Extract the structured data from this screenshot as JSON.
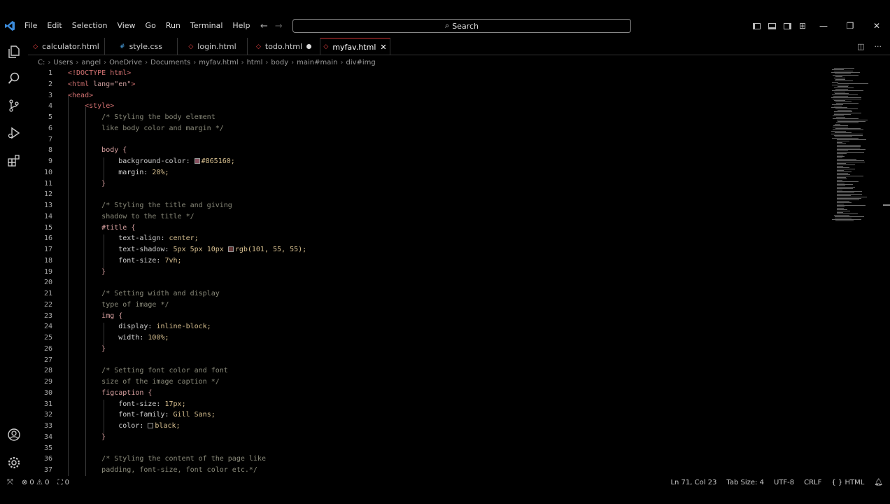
{
  "menu": [
    "File",
    "Edit",
    "Selection",
    "View",
    "Go",
    "Run",
    "Terminal",
    "Help"
  ],
  "search": {
    "placeholder": "Search"
  },
  "tabs": [
    {
      "label": "calculator.html"
    },
    {
      "label": "style.css"
    },
    {
      "label": "login.html"
    },
    {
      "label": "todo.html"
    },
    {
      "label": "myfav.html"
    }
  ],
  "breadcrumb": [
    "C:",
    "Users",
    "angel",
    "OneDrive",
    "Documents",
    "myfav.html",
    "html",
    "body",
    "main#main",
    "div#img"
  ],
  "code_lines": [
    {
      "n": "1",
      "parts": [
        [
          "tag",
          "<!DOCTYPE html>"
        ]
      ]
    },
    {
      "n": "2",
      "parts": [
        [
          "tag",
          "<html "
        ],
        [
          "attr",
          "lang=\"en\""
        ],
        [
          "tag",
          ">"
        ]
      ]
    },
    {
      "n": "3",
      "parts": [
        [
          "tag",
          "<head>"
        ]
      ]
    },
    {
      "n": "4",
      "parts": [
        [
          "pad",
          "    "
        ],
        [
          "tag",
          "<style>"
        ]
      ]
    },
    {
      "n": "5",
      "parts": [
        [
          "pad",
          "        "
        ],
        [
          "com",
          "/* Styling the body element"
        ]
      ]
    },
    {
      "n": "6",
      "parts": [
        [
          "pad",
          "        "
        ],
        [
          "com",
          "like body color and margin */"
        ]
      ]
    },
    {
      "n": "7",
      "parts": []
    },
    {
      "n": "8",
      "parts": [
        [
          "pad",
          "        "
        ],
        [
          "sel",
          "body {"
        ]
      ]
    },
    {
      "n": "9",
      "parts": [
        [
          "pad",
          "            "
        ],
        [
          "prop",
          "background-color: "
        ],
        [
          "swatch",
          "#865160"
        ],
        [
          "val",
          "#865160;"
        ]
      ]
    },
    {
      "n": "10",
      "parts": [
        [
          "pad",
          "            "
        ],
        [
          "prop",
          "margin: "
        ],
        [
          "val",
          "20%;"
        ]
      ]
    },
    {
      "n": "11",
      "parts": [
        [
          "pad",
          "        "
        ],
        [
          "sel",
          "}"
        ]
      ]
    },
    {
      "n": "12",
      "parts": []
    },
    {
      "n": "13",
      "parts": [
        [
          "pad",
          "        "
        ],
        [
          "com",
          "/* Styling the title and giving"
        ]
      ]
    },
    {
      "n": "14",
      "parts": [
        [
          "pad",
          "        "
        ],
        [
          "com",
          "shadow to the title */"
        ]
      ]
    },
    {
      "n": "15",
      "parts": [
        [
          "pad",
          "        "
        ],
        [
          "sel",
          "#title {"
        ]
      ]
    },
    {
      "n": "16",
      "parts": [
        [
          "pad",
          "            "
        ],
        [
          "prop",
          "text-align: "
        ],
        [
          "val",
          "center;"
        ]
      ]
    },
    {
      "n": "17",
      "parts": [
        [
          "pad",
          "            "
        ],
        [
          "prop",
          "text-shadow: "
        ],
        [
          "val",
          "5px 5px 10px "
        ],
        [
          "swatch",
          "#653737"
        ],
        [
          "val",
          "rgb(101, 55, 55);"
        ]
      ]
    },
    {
      "n": "18",
      "parts": [
        [
          "pad",
          "            "
        ],
        [
          "prop",
          "font-size: "
        ],
        [
          "val",
          "7vh;"
        ]
      ]
    },
    {
      "n": "19",
      "parts": [
        [
          "pad",
          "        "
        ],
        [
          "sel",
          "}"
        ]
      ]
    },
    {
      "n": "20",
      "parts": []
    },
    {
      "n": "21",
      "parts": [
        [
          "pad",
          "        "
        ],
        [
          "com",
          "/* Setting width and display"
        ]
      ]
    },
    {
      "n": "22",
      "parts": [
        [
          "pad",
          "        "
        ],
        [
          "com",
          "type of image */"
        ]
      ]
    },
    {
      "n": "23",
      "parts": [
        [
          "pad",
          "        "
        ],
        [
          "sel",
          "img {"
        ]
      ]
    },
    {
      "n": "24",
      "parts": [
        [
          "pad",
          "            "
        ],
        [
          "prop",
          "display: "
        ],
        [
          "val",
          "inline-block;"
        ]
      ]
    },
    {
      "n": "25",
      "parts": [
        [
          "pad",
          "            "
        ],
        [
          "prop",
          "width: "
        ],
        [
          "val",
          "100%;"
        ]
      ]
    },
    {
      "n": "26",
      "parts": [
        [
          "pad",
          "        "
        ],
        [
          "sel",
          "}"
        ]
      ]
    },
    {
      "n": "27",
      "parts": []
    },
    {
      "n": "28",
      "parts": [
        [
          "pad",
          "        "
        ],
        [
          "com",
          "/* Setting font color and font"
        ]
      ]
    },
    {
      "n": "29",
      "parts": [
        [
          "pad",
          "        "
        ],
        [
          "com",
          "size of the image caption */"
        ]
      ]
    },
    {
      "n": "30",
      "parts": [
        [
          "pad",
          "        "
        ],
        [
          "sel",
          "figcaption {"
        ]
      ]
    },
    {
      "n": "31",
      "parts": [
        [
          "pad",
          "            "
        ],
        [
          "prop",
          "font-size: "
        ],
        [
          "val",
          "17px;"
        ]
      ]
    },
    {
      "n": "32",
      "parts": [
        [
          "pad",
          "            "
        ],
        [
          "prop",
          "font-family: "
        ],
        [
          "val",
          "Gill Sans;"
        ]
      ]
    },
    {
      "n": "33",
      "parts": [
        [
          "pad",
          "            "
        ],
        [
          "prop",
          "color: "
        ],
        [
          "swatch",
          "#000000"
        ],
        [
          "val",
          "black;"
        ]
      ]
    },
    {
      "n": "34",
      "parts": [
        [
          "pad",
          "        "
        ],
        [
          "sel",
          "}"
        ]
      ]
    },
    {
      "n": "35",
      "parts": []
    },
    {
      "n": "36",
      "parts": [
        [
          "pad",
          "        "
        ],
        [
          "com",
          "/* Styling the content of the page like"
        ]
      ]
    },
    {
      "n": "37",
      "parts": [
        [
          "pad",
          "        "
        ],
        [
          "com",
          "padding, font-size, font color etc.*/"
        ]
      ]
    }
  ],
  "status": {
    "errors": "0",
    "warnings": "0",
    "ports": "0",
    "position": "Ln 71, Col 23",
    "tab_size": "Tab Size: 4",
    "encoding": "UTF-8",
    "eol": "CRLF",
    "language": "HTML"
  },
  "colors": {
    "accent_tab": "#c33333",
    "background": "#000000",
    "vscode_blue": "#3c8cdc"
  }
}
